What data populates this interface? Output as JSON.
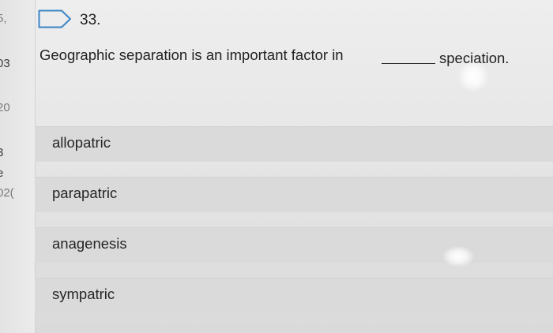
{
  "sidebar": {
    "partial_numbers": [
      "5,",
      "03",
      "20",
      "3",
      "e",
      "02("
    ]
  },
  "question": {
    "number": "33.",
    "text": "Geographic separation is an important factor in",
    "suffix": "speciation.",
    "flag_icon": "flag-outline-icon"
  },
  "options": [
    {
      "label": "allopatric"
    },
    {
      "label": "parapatric"
    },
    {
      "label": "anagenesis"
    },
    {
      "label": "sympatric"
    }
  ]
}
